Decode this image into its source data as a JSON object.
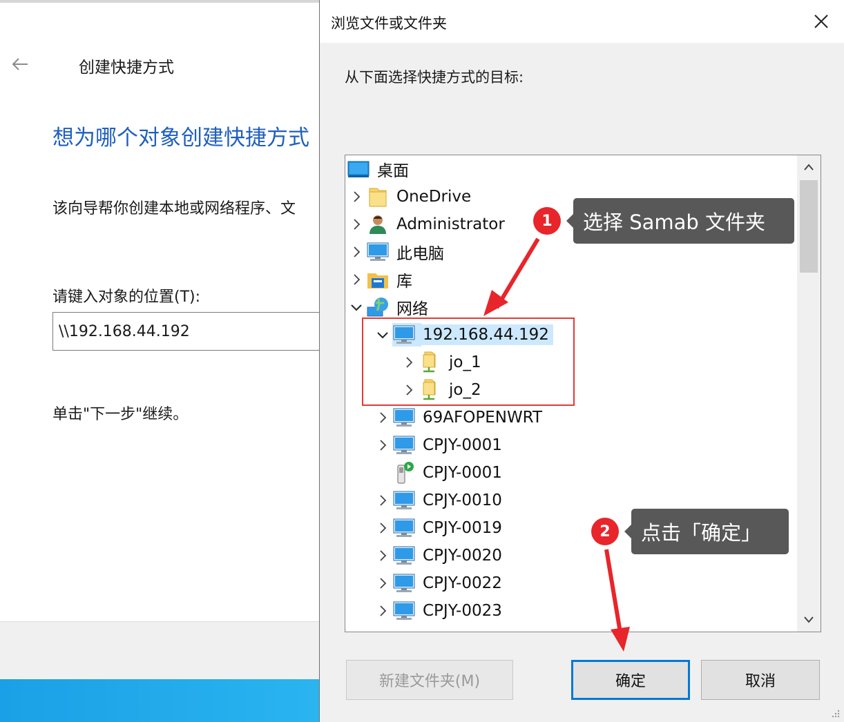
{
  "wizard": {
    "title": "创建快捷方式",
    "heading": "想为哪个对象创建快捷方式",
    "description": "该向导帮你创建本地或网络程序、文",
    "location_label": "请键入对象的位置(T):",
    "location_value": "\\\\192.168.44.192",
    "hint": "单击\"下一步\"继续。"
  },
  "dialog": {
    "title": "浏览文件或文件夹",
    "instruction": "从下面选择快捷方式的目标:",
    "tree": [
      {
        "label": "桌面",
        "level": 0,
        "expander": "none",
        "icon": "desktop-icon"
      },
      {
        "label": "OneDrive",
        "level": 1,
        "expander": "collapsed",
        "icon": "folder-icon"
      },
      {
        "label": "Administrator",
        "level": 1,
        "expander": "collapsed",
        "icon": "user-icon"
      },
      {
        "label": "此电脑",
        "level": 1,
        "expander": "collapsed",
        "icon": "computer-icon"
      },
      {
        "label": "库",
        "level": 1,
        "expander": "collapsed",
        "icon": "library-icon"
      },
      {
        "label": "网络",
        "level": 1,
        "expander": "expanded",
        "icon": "network-icon"
      },
      {
        "label": "192.168.44.192",
        "level": 2,
        "expander": "expanded",
        "icon": "computer-icon",
        "selected": true
      },
      {
        "label": "jo_1",
        "level": 3,
        "expander": "collapsed",
        "icon": "shared-folder-icon"
      },
      {
        "label": "jo_2",
        "level": 3,
        "expander": "collapsed",
        "icon": "shared-folder-icon"
      },
      {
        "label": "69AFOPENWRT",
        "level": 2,
        "expander": "collapsed",
        "icon": "computer-icon"
      },
      {
        "label": "CPJY-0001",
        "level": 2,
        "expander": "collapsed",
        "icon": "computer-icon"
      },
      {
        "label": "CPJY-0001",
        "level": 2,
        "expander": "none",
        "icon": "media-device-icon"
      },
      {
        "label": "CPJY-0010",
        "level": 2,
        "expander": "collapsed",
        "icon": "computer-icon"
      },
      {
        "label": "CPJY-0019",
        "level": 2,
        "expander": "collapsed",
        "icon": "computer-icon"
      },
      {
        "label": "CPJY-0020",
        "level": 2,
        "expander": "collapsed",
        "icon": "computer-icon"
      },
      {
        "label": "CPJY-0022",
        "level": 2,
        "expander": "collapsed",
        "icon": "computer-icon"
      },
      {
        "label": "CPJY-0023",
        "level": 2,
        "expander": "collapsed",
        "icon": "computer-icon"
      }
    ],
    "buttons": {
      "new_folder": "新建文件夹(M)",
      "ok": "确定",
      "cancel": "取消"
    }
  },
  "annotations": {
    "step1_number": "1",
    "step1_text": "选择 Samab 文件夹",
    "step2_number": "2",
    "step2_text": "点击「确定」"
  },
  "colors": {
    "heading_blue": "#1f5fbf",
    "selection": "#cce8ff",
    "ok_border": "#0078d7",
    "badge_red": "#e8252a",
    "callout_gray": "#585858"
  }
}
